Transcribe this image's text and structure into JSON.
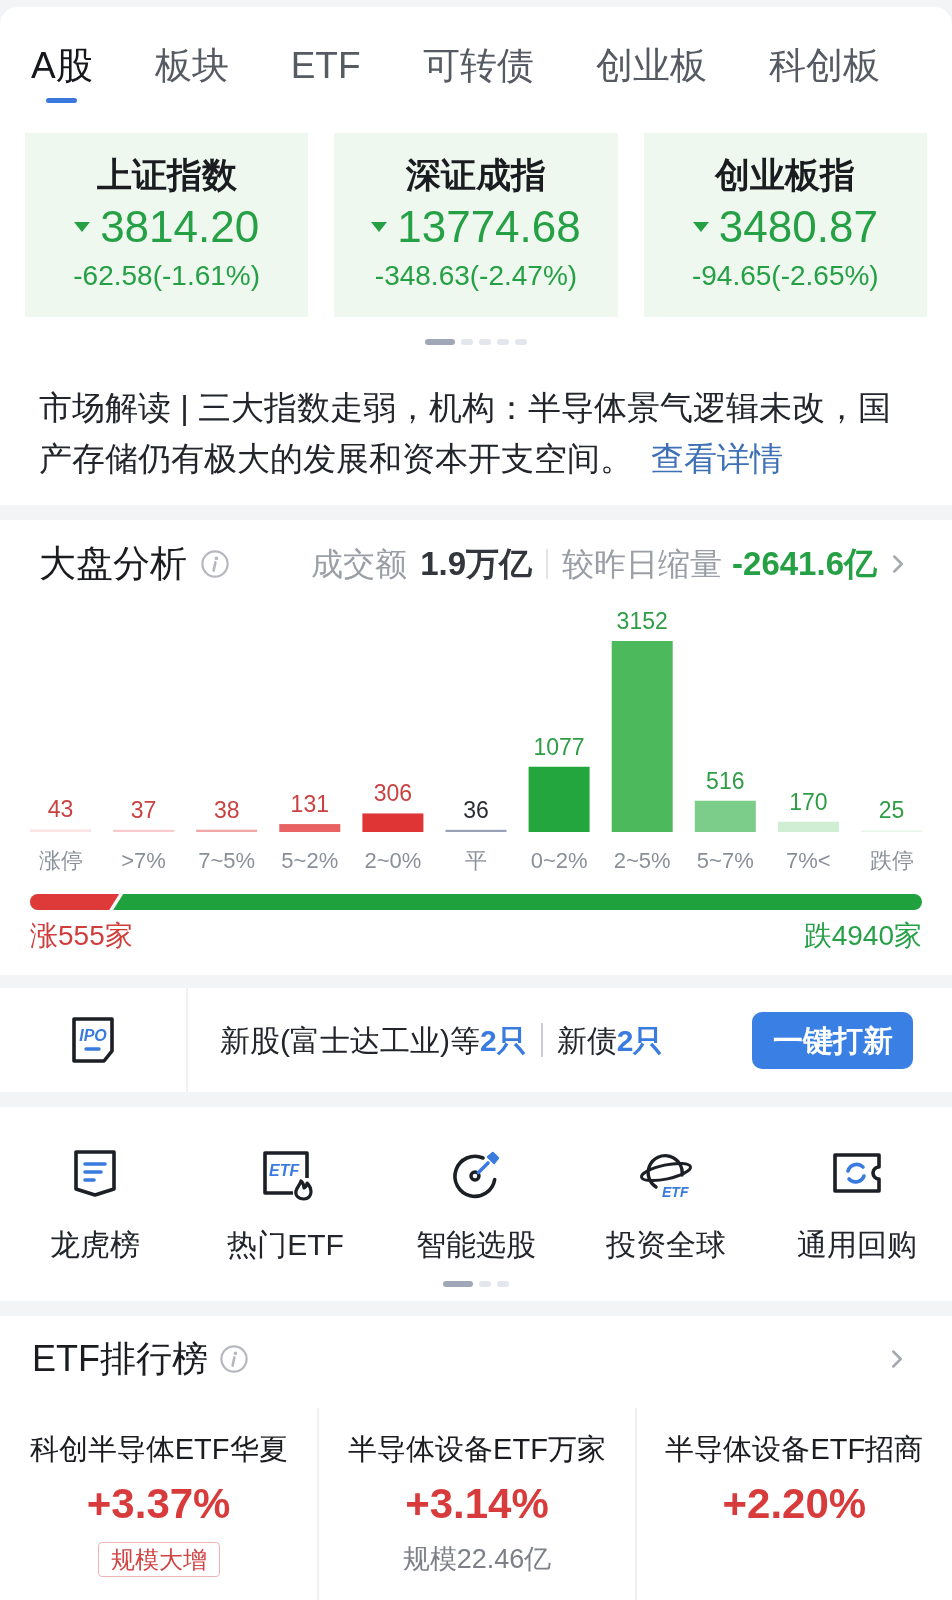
{
  "tabs": [
    {
      "label": "A股",
      "selected": true
    },
    {
      "label": "板块",
      "selected": false
    },
    {
      "label": "ETF",
      "selected": false
    },
    {
      "label": "可转债",
      "selected": false
    },
    {
      "label": "创业板",
      "selected": false
    },
    {
      "label": "科创板",
      "selected": false
    }
  ],
  "indices": [
    {
      "name": "上证指数",
      "falling": true,
      "value": "3814.20",
      "change": "-62.58(-1.61%)"
    },
    {
      "name": "深证成指",
      "falling": true,
      "value": "13774.68",
      "change": "-348.63(-2.47%)"
    },
    {
      "name": "创业板指",
      "falling": true,
      "value": "3480.87",
      "change": "-94.65(-2.65%)"
    }
  ],
  "indices_pager": [
    {
      "selected": true
    },
    {
      "selected": false
    },
    {
      "selected": false
    },
    {
      "selected": false
    },
    {
      "selected": false
    }
  ],
  "market_news": {
    "text": "市场解读 | 三大指数走弱，机构：半导体景气逻辑未改，国产存储仍有极大的发展和资本开支空间。",
    "link": "查看详情"
  },
  "overview": {
    "title": "大盘分析",
    "turnover_label": "成交额",
    "turnover": "1.9万亿",
    "compare_label": "较昨日缩量",
    "compare_value": "-2641.6亿",
    "compare_falling": true,
    "chart_data": {
      "type": "bar",
      "categories": [
        "涨停",
        ">7%",
        "7~5%",
        "5~2%",
        "2~0%",
        "平",
        "0~2%",
        "2~5%",
        "5~7%",
        "7%<",
        "跌停"
      ],
      "series": [
        {
          "colors": [
            "#fbe4e4",
            "#f8cccc",
            "#f1a7a7",
            "#e86262",
            "#e03535",
            "#97a1b5",
            "#22a63d",
            "#4bb95c",
            "#7bcd89",
            "#cfeed4",
            "#e5f5e7"
          ],
          "values": [
            43,
            37,
            38,
            131,
            306,
            36,
            1077,
            3152,
            516,
            170,
            25
          ]
        }
      ],
      "data_labels": true
    },
    "breadth": {
      "level": 0.1,
      "up": "涨555家",
      "down": "跌4940家"
    }
  },
  "ipo": {
    "icon_text": "IPO",
    "new_stocks": {
      "label": "新股(富士达工业)等",
      "count": "2只"
    },
    "new_bonds": {
      "label": "新债",
      "count": "2只"
    },
    "button": "一键打新"
  },
  "shortcuts": [
    {
      "kind": "list",
      "label": "龙虎榜"
    },
    {
      "kind": "etf",
      "icon_text": "ETF",
      "label": "热门ETF"
    },
    {
      "kind": "target",
      "label": "智能选股"
    },
    {
      "kind": "globe",
      "icon_text": "ETF",
      "label": "投资全球"
    },
    {
      "kind": "ticket",
      "label": "通用回购"
    }
  ],
  "shortcuts_pager": [
    {
      "selected": true
    },
    {
      "selected": false
    },
    {
      "selected": false
    }
  ],
  "etf_ranking": {
    "title": "ETF排行榜",
    "items": [
      {
        "name": "科创半导体ETF华夏",
        "falling": false,
        "change": "+3.37%",
        "note": {
          "kind": "badge",
          "text": "规模大增"
        }
      },
      {
        "name": "半导体设备ETF万家",
        "falling": false,
        "change": "+3.14%",
        "note": {
          "kind": "text",
          "text": "规模22.46亿"
        }
      },
      {
        "name": "半导体设备ETF招商",
        "falling": false,
        "change": "+2.20%"
      }
    ]
  }
}
